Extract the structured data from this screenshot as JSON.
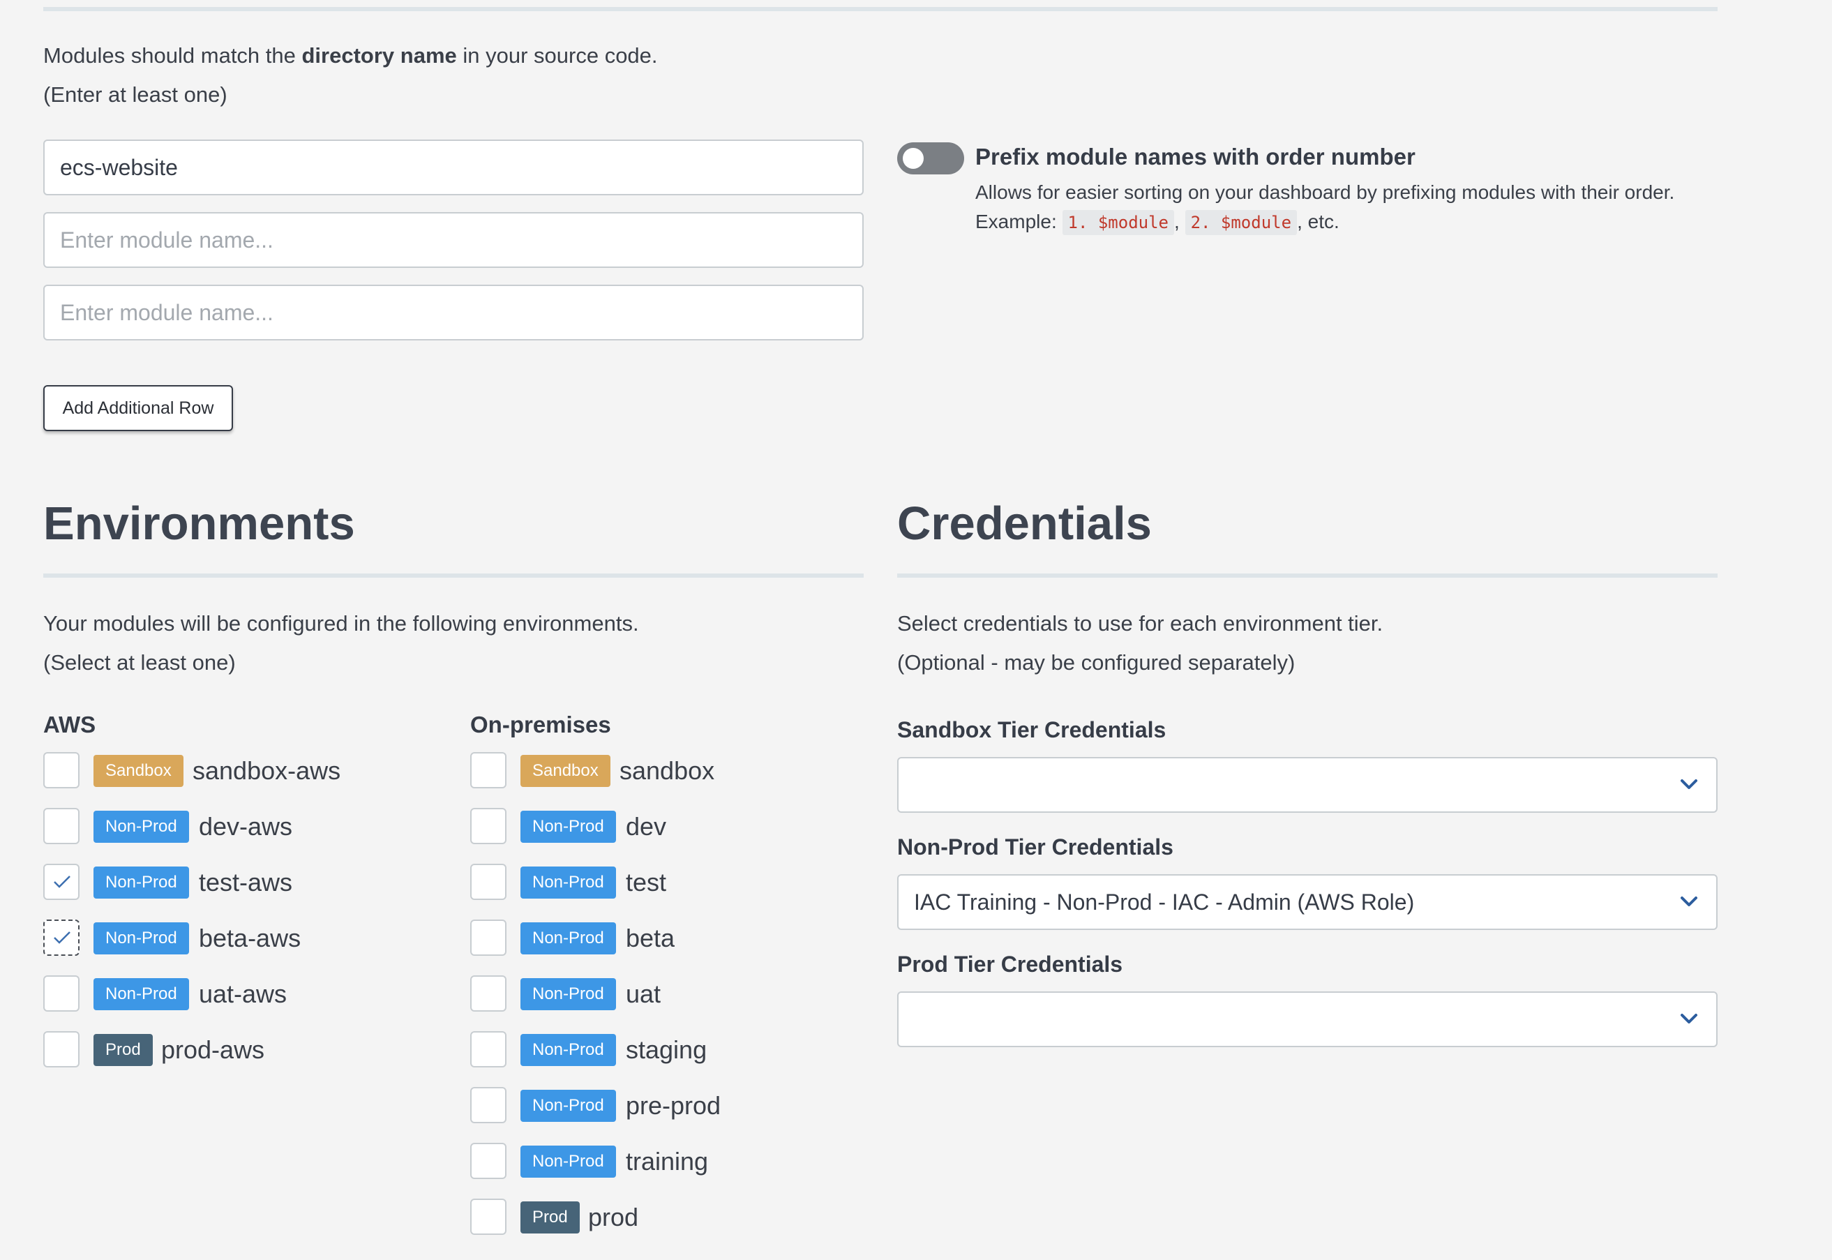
{
  "modules": {
    "intro_prefix": "Modules should match the ",
    "intro_bold": "directory name",
    "intro_suffix": " in your source code.",
    "note": "(Enter at least one)",
    "inputs": [
      {
        "value": "ecs-website",
        "placeholder": "Enter module name..."
      },
      {
        "value": "",
        "placeholder": "Enter module name..."
      },
      {
        "value": "",
        "placeholder": "Enter module name..."
      }
    ],
    "add_row_label": "Add Additional Row",
    "prefix_toggle": {
      "enabled": false,
      "title": "Prefix module names with order number",
      "description": "Allows for easier sorting on your dashboard by prefixing modules with their order.",
      "example_label": "Example: ",
      "example_code_1": "1. $module",
      "example_sep": ",",
      "example_code_2": "2. $module",
      "example_suffix": ", etc."
    }
  },
  "environments": {
    "title": "Environments",
    "description": "Your modules will be configured in the following environments.",
    "note": "(Select at least one)",
    "groups": [
      {
        "label": "AWS",
        "items": [
          {
            "tier": "Sandbox",
            "name": "sandbox-aws",
            "checked": false
          },
          {
            "tier": "Non-Prod",
            "name": "dev-aws",
            "checked": false
          },
          {
            "tier": "Non-Prod",
            "name": "test-aws",
            "checked": true
          },
          {
            "tier": "Non-Prod",
            "name": "beta-aws",
            "checked": true
          },
          {
            "tier": "Non-Prod",
            "name": "uat-aws",
            "checked": false
          },
          {
            "tier": "Prod",
            "name": "prod-aws",
            "checked": false
          }
        ]
      },
      {
        "label": "On-premises",
        "items": [
          {
            "tier": "Sandbox",
            "name": "sandbox",
            "checked": false
          },
          {
            "tier": "Non-Prod",
            "name": "dev",
            "checked": false
          },
          {
            "tier": "Non-Prod",
            "name": "test",
            "checked": false
          },
          {
            "tier": "Non-Prod",
            "name": "beta",
            "checked": false
          },
          {
            "tier": "Non-Prod",
            "name": "uat",
            "checked": false
          },
          {
            "tier": "Non-Prod",
            "name": "staging",
            "checked": false
          },
          {
            "tier": "Non-Prod",
            "name": "pre-prod",
            "checked": false
          },
          {
            "tier": "Non-Prod",
            "name": "training",
            "checked": false
          },
          {
            "tier": "Prod",
            "name": "prod",
            "checked": false
          }
        ]
      }
    ]
  },
  "credentials": {
    "title": "Credentials",
    "description": "Select credentials to use for each environment tier.",
    "note": "(Optional - may be configured separately)",
    "fields": [
      {
        "label": "Sandbox Tier Credentials",
        "value": ""
      },
      {
        "label": "Non-Prod Tier Credentials",
        "value": "IAC Training - Non-Prod - IAC - Admin (AWS Role)"
      },
      {
        "label": "Prod Tier Credentials",
        "value": ""
      }
    ]
  },
  "tier_colors": {
    "Sandbox": "#d9a75a",
    "Non-Prod": "#3d97e6",
    "Prod": "#476478"
  },
  "icons": {
    "checkbox_checked": "check-icon",
    "select": "chevron-down-icon",
    "toggle": "toggle-switch"
  }
}
